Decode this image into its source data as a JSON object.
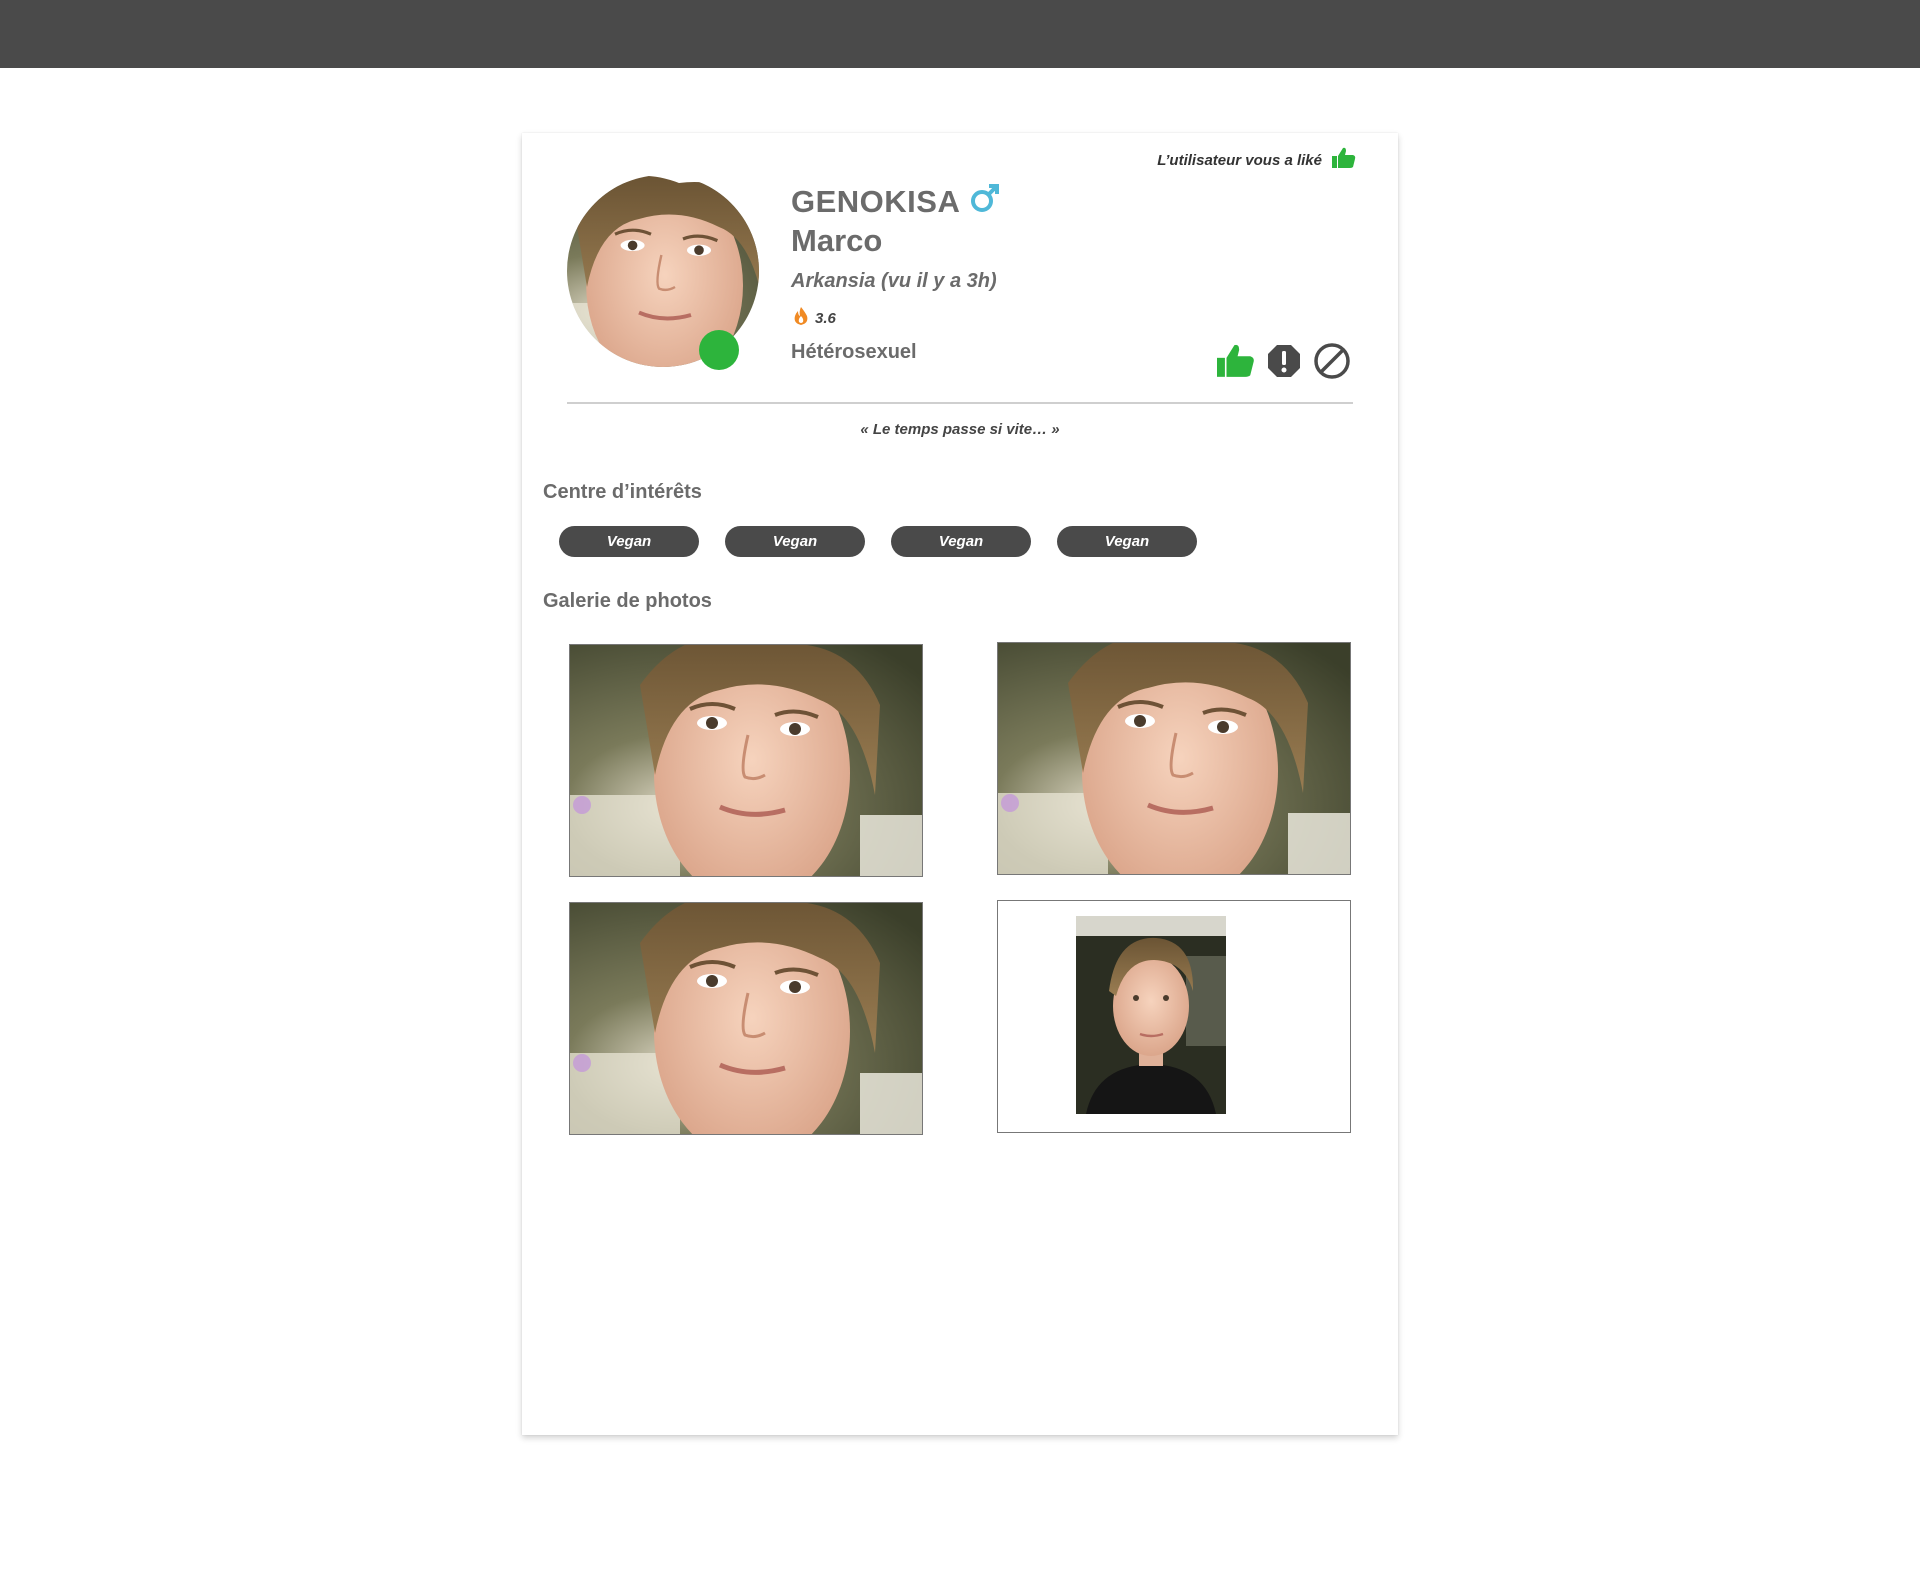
{
  "header": {},
  "profile": {
    "liked_notice": "L’utilisateur vous a liké",
    "username": "GENOKISA",
    "gender_symbol": "♂",
    "first_name": "Marco",
    "location": "Arkansia (vu il y a 3h)",
    "score": "3.6",
    "orientation": "Hétérosexuel",
    "bio_quote": "« Le temps passe si vite… »",
    "online": true
  },
  "actions": [
    {
      "name": "like",
      "icon": "thumbs-up-icon"
    },
    {
      "name": "report",
      "icon": "alert-octagon-icon"
    },
    {
      "name": "block",
      "icon": "block-icon"
    }
  ],
  "interests": {
    "title": "Centre d’intérêts",
    "tags": [
      "Vegan",
      "Vegan",
      "Vegan",
      "Vegan"
    ]
  },
  "gallery": {
    "title": "Galerie de photos",
    "photo_count": 4
  },
  "colors": {
    "topbar": "#4a4a4a",
    "accent_green": "#2db43c",
    "gender_blue": "#4fb8d8",
    "flame_orange": "#f08a24",
    "tag_bg": "#4a4a4a"
  }
}
